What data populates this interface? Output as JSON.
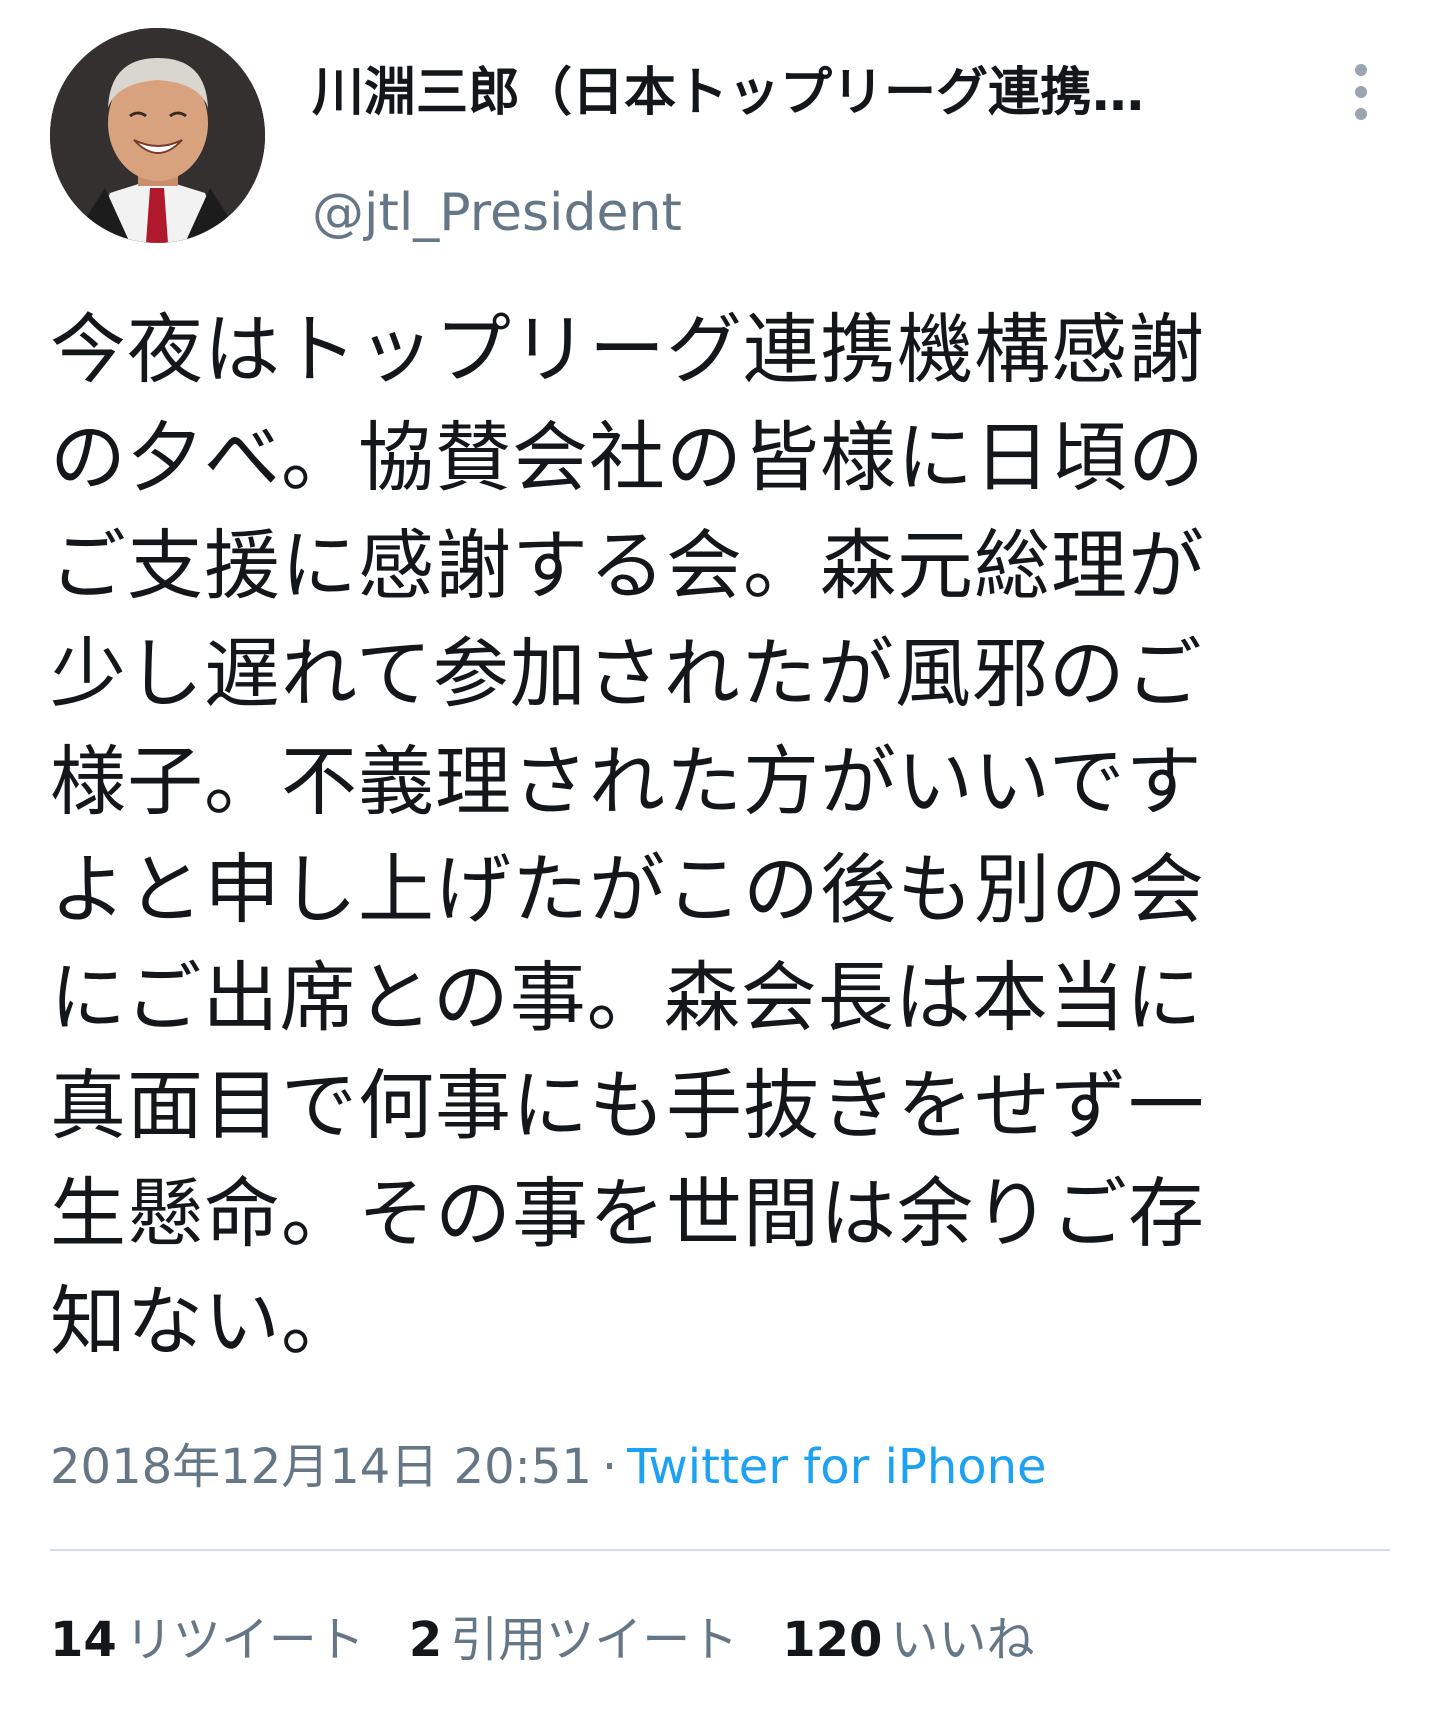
{
  "user": {
    "display_name": "川淵三郎（日本トップリーグ連携…",
    "handle": "@jtl_President"
  },
  "tweet": {
    "text": "今夜はトップリーグ連携機構感謝の夕べ。協賛会社の皆様に日頃のご支援に感謝する会。森元総理が少し遅れて参加されたが風邪のご様子。不義理された方がいいですよと申し上げたがこの後も別の会にご出席との事。森会長は本当に真面目で何事にも手抜きをせず一生懸命。その事を世間は余りご存知ない。",
    "lines": [
      "今夜はトップリーグ連携機構感謝",
      "の夕べ。協賛会社の皆様に日頃の",
      "ご支援に感謝する会。森元総理が",
      "少し遅れて参加されたが風邪のご",
      "様子。不義理された方がいいです",
      "よと申し上げたがこの後も別の会",
      "にご出席との事。森会長は本当に",
      "真面目で何事にも手抜きをせず一",
      "生懸命。その事を世間は余りご存",
      "知ない。"
    ],
    "timestamp": "2018年12月14日 20:51",
    "separator": "·",
    "source": "Twitter for iPhone"
  },
  "stats": {
    "retweets": {
      "count": "14",
      "label": "リツイート"
    },
    "quotes": {
      "count": "2",
      "label": "引用ツイート"
    },
    "likes": {
      "count": "120",
      "label": "いいね"
    }
  },
  "colors": {
    "text": "#14171a",
    "secondary": "#657786",
    "link": "#1da1f2",
    "divider": "#d5dde4"
  },
  "icons": {
    "more": "more-vertical-icon"
  }
}
